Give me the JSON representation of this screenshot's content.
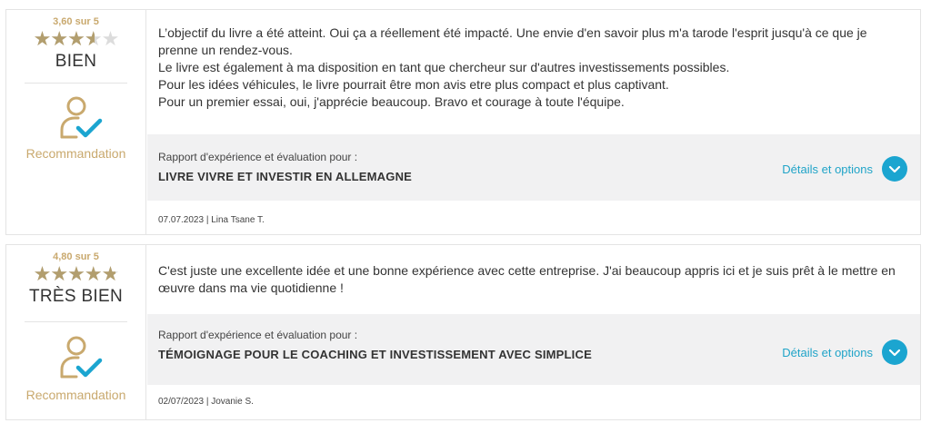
{
  "reviews": [
    {
      "score_text": "3,60 sur 5",
      "rating": 3.6,
      "grade": "BIEN",
      "recommendation": "Recommandation",
      "paragraphs": [
        "L’objectif du livre a été atteint. Oui ça a réellement été impacté. Une envie d'en savoir plus m'a tarode l'esprit jusqu'à ce que je prenne un rendez-vous.",
        "Le livre est également à ma disposition en tant que chercheur sur d'autres investissements possibles.",
        "Pour les idées véhicules, le livre pourrait être mon avis etre plus compact et plus captivant.",
        "Pour un premier essai, oui, j'apprécie beaucoup. Bravo et courage à toute l'équipe."
      ],
      "report_label": "Rapport d'expérience et évaluation pour :",
      "product": "LIVRE VIVRE ET INVESTIR EN ALLEMAGNE",
      "details_label": "Détails et options",
      "meta": "07.07.2023 | Lina Tsane T."
    },
    {
      "score_text": "4,80 sur 5",
      "rating": 4.8,
      "grade": "TRÈS BIEN",
      "recommendation": "Recommandation",
      "paragraphs": [
        "C'est juste une excellente idée et une bonne expérience avec cette entreprise. J'ai beaucoup appris ici et je suis prêt à le mettre en œuvre dans ma vie quotidienne !"
      ],
      "report_label": "Rapport d'expérience et évaluation pour :",
      "product": "TÉMOIGNAGE POUR LE COACHING ET INVESTISSEMENT AVEC SIMPLICE",
      "details_label": "Détails et options",
      "meta": "02/07/2023 | Jovanie S."
    }
  ],
  "icons": {
    "star": "star-icon",
    "recommendation": "person-check-icon",
    "details": "chevron-down-icon"
  },
  "colors": {
    "gold": "#c9a96e",
    "star_fill": "#b29e6e",
    "star_empty": "#dcdcdc",
    "accent": "#1ba5d0",
    "box_bg": "#f1f1f2"
  }
}
